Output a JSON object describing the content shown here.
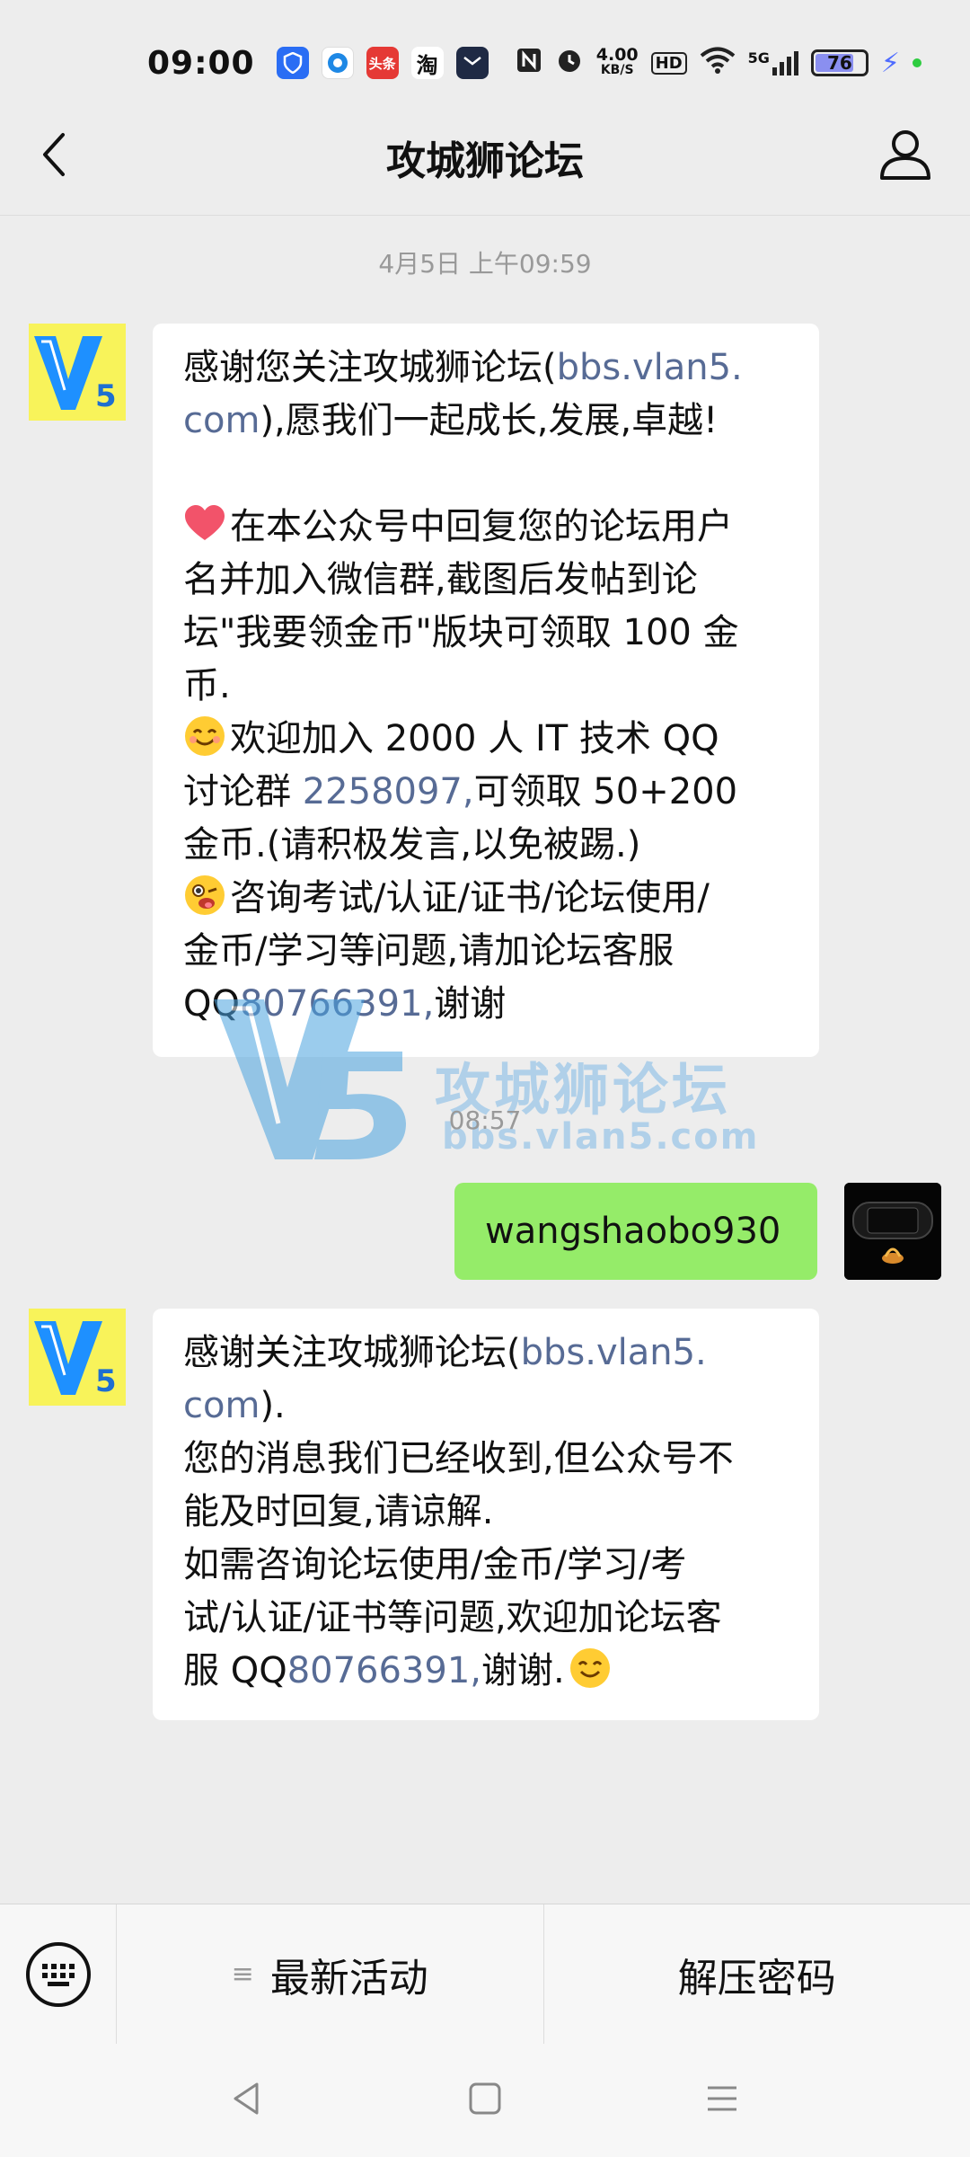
{
  "status_bar": {
    "time": "09:00",
    "speed_value": "4.00",
    "speed_unit": "KB/S",
    "hd": "HD",
    "network": "5G",
    "battery": "76",
    "apps": [
      "shield-app-icon",
      "blue-circle-app-icon",
      "toutiao-app-icon",
      "taobao-app-icon",
      "mail-app-icon"
    ],
    "toutiao_label": "头条",
    "taobao_label": "淘"
  },
  "header": {
    "title": "攻城狮论坛"
  },
  "chat": {
    "timestamp1": "4月5日 上午09:59",
    "timestamp2": "08:57",
    "msg1": {
      "l1a": "感谢您关注攻城狮论坛(",
      "l1b": "bbs.vlan5.",
      "l2a": "com",
      "l2b": "),愿我们一起成长,发展,卓越!",
      "l3": "在本公众号中回复您的论坛用户",
      "l4": "名并加入微信群,截图后发帖到论",
      "l5": "坛\"我要领金币\"版块可领取 100 金",
      "l6": "币.",
      "l7": "欢迎加入 2000 人 IT 技术 QQ",
      "l8a": "讨论群 ",
      "l8b": "2258097,",
      "l8c": "可领取 50+200",
      "l9": "金币.(请积极发言,以免被踢.)",
      "l10": "咨询考试/认证/证书/论坛使用/",
      "l11": "金币/学习等问题,请加论坛客服",
      "l12a": "QQ",
      "l12b": "80766391,",
      "l12c": "谢谢"
    },
    "msg_me": "wangshaobo930",
    "msg2": {
      "l1a": "感谢关注攻城狮论坛(",
      "l1b": "bbs.vlan5.",
      "l2a": "com",
      "l2b": ").",
      "l3": "您的消息我们已经收到,但公众号不",
      "l4": "能及时回复,请谅解.",
      "l5": "如需咨询论坛使用/金币/学习/考",
      "l6": "试/认证/证书等问题,欢迎加论坛客",
      "l7a": "服 QQ",
      "l7b": "80766391,",
      "l7c": "谢谢."
    },
    "watermark": {
      "logo_text": "V5",
      "name": "攻城狮论坛",
      "url": "bbs.vlan5.com"
    }
  },
  "bottom_menu": {
    "item1": "最新活动",
    "item2": "解压密码"
  },
  "colors": {
    "link": "#576b95",
    "me_bubble": "#95ec69",
    "background": "#ededed"
  }
}
